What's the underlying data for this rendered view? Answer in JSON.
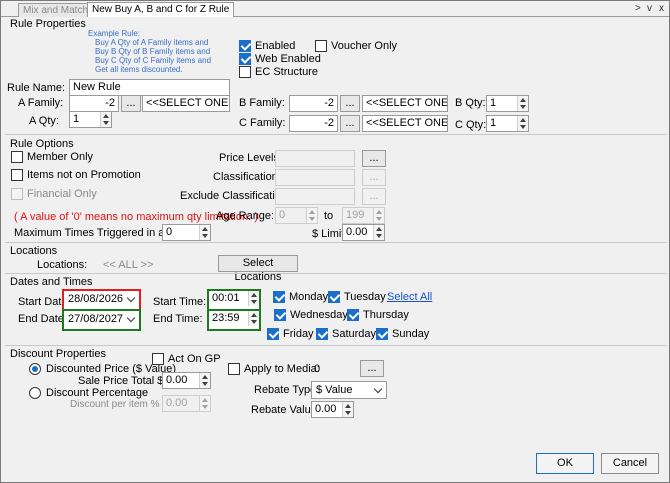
{
  "tabs": [
    {
      "label": "Mix and Match",
      "active": false
    },
    {
      "label": "New Buy A, B and C for Z Rule",
      "active": true
    }
  ],
  "window_controls": {
    "next": ">",
    "menu": "v",
    "close": "x"
  },
  "rule_properties": {
    "title": "Rule Properties",
    "example_rule": [
      "Example Rule:",
      "Buy A Qty of A Family items and",
      "Buy B Qty of B Family items and",
      "Buy C Qty of C Family items and",
      "Get all items discounted."
    ],
    "enabled_label": "Enabled",
    "enabled": true,
    "web_enabled_label": "Web Enabled",
    "web_enabled": true,
    "ec_structure_label": "EC Structure",
    "ec_structure": false,
    "voucher_only_label": "Voucher Only",
    "voucher_only": false,
    "rule_name_label": "Rule Name:",
    "rule_name": "New Rule",
    "a_family_label": "A Family:",
    "a_family_code": "-2",
    "a_family_select": "<<SELECT ONE>>",
    "a_qty_label": "A Qty:",
    "a_qty": "1",
    "b_family_label": "B Family:",
    "b_family_code": "-2",
    "b_family_select": "<<SELECT ONE>>",
    "b_qty_label": "B Qty:",
    "b_qty": "1",
    "c_family_label": "C Family:",
    "c_family_code": "-2",
    "c_family_select": "<<SELECT ONE>>",
    "c_qty_label": "C Qty:",
    "c_qty": "1",
    "browse_label": "..."
  },
  "rule_options": {
    "title": "Rule Options",
    "member_only_label": "Member Only",
    "member_only": false,
    "items_not_on_promotion_label": "Items not on Promotion",
    "items_not_on_promotion": false,
    "financial_only_label": "Financial Only",
    "financial_only": false,
    "price_levels_label": "Price Levels:",
    "classifications_label": "Classifications:",
    "exclude_classifications_label": "Exclude Classifications:",
    "max_qty_note": "( A value of '0' means no maximum qty limitation. )",
    "max_times_label": "Maximum Times Triggered in a Sale:",
    "max_times": "0",
    "age_range_label": "Age Range:",
    "age_from": "0",
    "age_to_label": "to",
    "age_to": "199",
    "limit_label": "$ Limit",
    "limit": "0.00"
  },
  "locations": {
    "title": "Locations",
    "locations_label": "Locations:",
    "locations_value": "<< ALL >>",
    "select_button": "Select Locations"
  },
  "dates_and_times": {
    "title": "Dates and Times",
    "start_date_label": "Start Date:",
    "start_date": "28/08/2026",
    "end_date_label": "End Date:",
    "end_date": "27/08/2027",
    "start_time_label": "Start Time:",
    "start_time": "00:01",
    "end_time_label": "End Time:",
    "end_time": "23:59",
    "days": {
      "monday": "Monday",
      "tuesday": "Tuesday",
      "wednesday": "Wednesday",
      "thursday": "Thursday",
      "friday": "Friday",
      "saturday": "Saturday",
      "sunday": "Sunday"
    },
    "select_all": "Select All"
  },
  "discount_properties": {
    "title": "Discount Properties",
    "discounted_price_label": "Discounted Price ($ Value)",
    "discounted_price_selected": true,
    "sale_price_total_label": "Sale Price Total $",
    "sale_price_total": "0.00",
    "discount_percentage_label": "Discount Percentage",
    "discount_percentage_selected": false,
    "discount_per_item_label": "Discount per item %",
    "discount_per_item": "0.00",
    "act_on_gp_label": "Act On GP",
    "act_on_gp": false,
    "apply_to_media_label": "Apply to Media:",
    "apply_to_media_value": "0",
    "apply_to_media": false,
    "rebate_type_label": "Rebate Type",
    "rebate_type": "$ Value",
    "rebate_value_label": "Rebate Value",
    "rebate_value": "0.00"
  },
  "footer": {
    "ok": "OK",
    "cancel": "Cancel"
  },
  "colors": {
    "accent": "#1a6fc9",
    "highlight_red": "#e02020",
    "highlight_green": "#1f7a1f",
    "warning_text": "#e01010"
  }
}
